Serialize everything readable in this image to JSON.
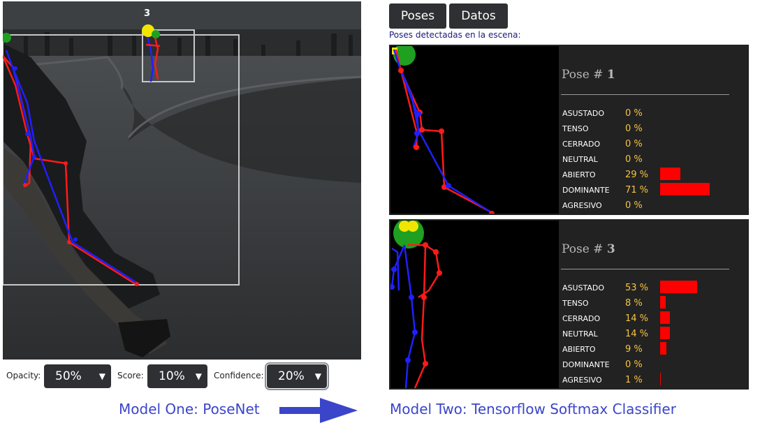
{
  "scene": {
    "pose_number": "3"
  },
  "controls": [
    {
      "label": "Opacity:",
      "value": "50%"
    },
    {
      "label": "Score:",
      "value": "10%"
    },
    {
      "label": "Confidence:",
      "value": "20%"
    }
  ],
  "captions": {
    "left": "Model One: PoseNet",
    "right": "Model Two: Tensorflow Softmax Classifier"
  },
  "tabs": [
    {
      "label": "Poses"
    },
    {
      "label": "Datos"
    }
  ],
  "poses_heading": "Poses detectadas en la escena:",
  "cards": [
    {
      "title_prefix": "Pose #",
      "number": "1",
      "emotions": [
        {
          "name": "ASUSTADO",
          "pct_text": "0 %",
          "value": 0
        },
        {
          "name": "TENSO",
          "pct_text": "0 %",
          "value": 0
        },
        {
          "name": "CERRADO",
          "pct_text": "0 %",
          "value": 0
        },
        {
          "name": "NEUTRAL",
          "pct_text": "0 %",
          "value": 0
        },
        {
          "name": "ABIERTO",
          "pct_text": "29 %",
          "value": 29
        },
        {
          "name": "DOMINANTE",
          "pct_text": "71 %",
          "value": 71
        },
        {
          "name": "AGRESIVO",
          "pct_text": "0 %",
          "value": 0
        }
      ]
    },
    {
      "title_prefix": "Pose #",
      "number": "3",
      "emotions": [
        {
          "name": "ASUSTADO",
          "pct_text": "53 %",
          "value": 53
        },
        {
          "name": "TENSO",
          "pct_text": "8 %",
          "value": 8
        },
        {
          "name": "CERRADO",
          "pct_text": "14 %",
          "value": 14
        },
        {
          "name": "NEUTRAL",
          "pct_text": "14 %",
          "value": 14
        },
        {
          "name": "ABIERTO",
          "pct_text": "9 %",
          "value": 9
        },
        {
          "name": "DOMINANTE",
          "pct_text": "0 %",
          "value": 0
        },
        {
          "name": "AGRESIVO",
          "pct_text": "1 %",
          "value": 1
        }
      ]
    }
  ],
  "colors": {
    "bar": "#ff0000",
    "percent": "#f5c542",
    "caption": "#3b45c9",
    "card_bg": "#222222"
  }
}
